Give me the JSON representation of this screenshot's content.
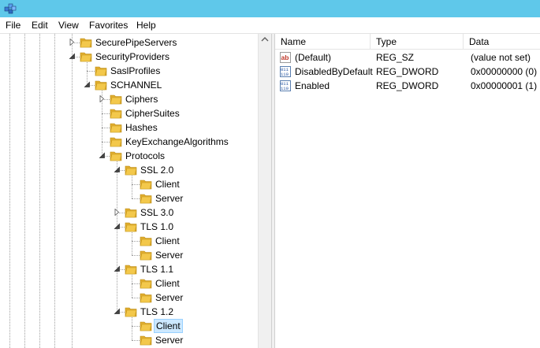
{
  "menu": [
    "File",
    "Edit",
    "View",
    "Favorites",
    "Help"
  ],
  "tree": [
    {
      "label": "SecurePipeServers",
      "level": 0,
      "expander": "collapsed"
    },
    {
      "label": "SecurityProviders",
      "level": 0,
      "expander": "expanded"
    },
    {
      "label": "SaslProfiles",
      "level": 1,
      "expander": "none"
    },
    {
      "label": "SCHANNEL",
      "level": 1,
      "expander": "expanded"
    },
    {
      "label": "Ciphers",
      "level": 2,
      "expander": "collapsed"
    },
    {
      "label": "CipherSuites",
      "level": 2,
      "expander": "none"
    },
    {
      "label": "Hashes",
      "level": 2,
      "expander": "none"
    },
    {
      "label": "KeyExchangeAlgorithms",
      "level": 2,
      "expander": "none"
    },
    {
      "label": "Protocols",
      "level": 2,
      "expander": "expanded"
    },
    {
      "label": "SSL 2.0",
      "level": 3,
      "expander": "expanded"
    },
    {
      "label": "Client",
      "level": 4,
      "expander": "none"
    },
    {
      "label": "Server",
      "level": 4,
      "expander": "none"
    },
    {
      "label": "SSL 3.0",
      "level": 3,
      "expander": "collapsed"
    },
    {
      "label": "TLS 1.0",
      "level": 3,
      "expander": "expanded"
    },
    {
      "label": "Client",
      "level": 4,
      "expander": "none"
    },
    {
      "label": "Server",
      "level": 4,
      "expander": "none"
    },
    {
      "label": "TLS 1.1",
      "level": 3,
      "expander": "expanded"
    },
    {
      "label": "Client",
      "level": 4,
      "expander": "none"
    },
    {
      "label": "Server",
      "level": 4,
      "expander": "none"
    },
    {
      "label": "TLS 1.2",
      "level": 3,
      "expander": "expanded"
    },
    {
      "label": "Client",
      "level": 4,
      "expander": "none",
      "selected": true
    },
    {
      "label": "Server",
      "level": 4,
      "expander": "none"
    }
  ],
  "columns": {
    "name": "Name",
    "type": "Type",
    "data": "Data"
  },
  "values": [
    {
      "icon": "string-value-icon",
      "name": "(Default)",
      "type": "REG_SZ",
      "data": "(value not set)"
    },
    {
      "icon": "binary-value-icon",
      "name": "DisabledByDefault",
      "type": "REG_DWORD",
      "data": "0x00000000 (0)"
    },
    {
      "icon": "binary-value-icon",
      "name": "Enabled",
      "type": "REG_DWORD",
      "data": "0x00000001 (1)"
    }
  ],
  "colors": {
    "titlebar": "#5fc8ea",
    "selection": "#cce8ff",
    "selection_border": "#99d1ff",
    "folder": "#f3c84b"
  }
}
